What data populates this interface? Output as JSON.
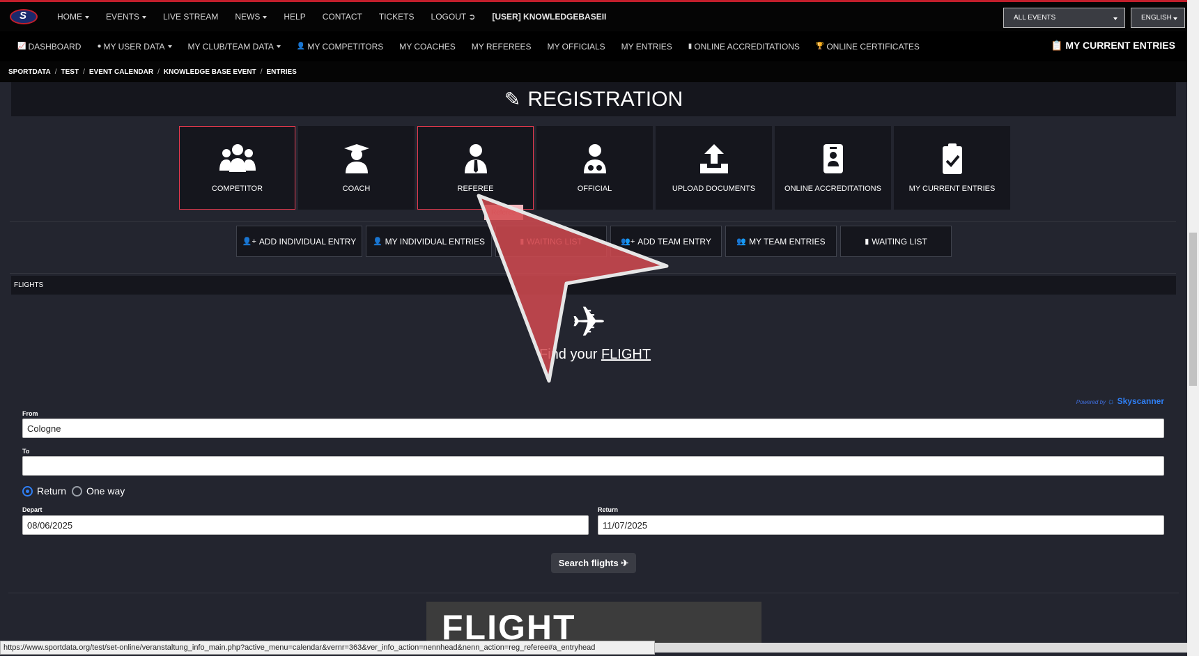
{
  "nav": {
    "home": "HOME",
    "events": "EVENTS",
    "live_stream": "LIVE STREAM",
    "news": "NEWS",
    "help": "HELP",
    "contact": "CONTACT",
    "tickets": "TICKETS",
    "logout": "LOGOUT",
    "user": "[USER] KNOWLEDGEBASEII",
    "events_select": "ALL EVENTS",
    "language_select": "ENGLISH"
  },
  "subnav": {
    "dashboard": "DASHBOARD",
    "my_user_data": "MY USER DATA",
    "my_club_team_data": "MY CLUB/TEAM DATA",
    "my_competitors": "MY COMPETITORS",
    "my_coaches": "MY COACHES",
    "my_referees": "MY REFEREES",
    "my_officials": "MY OFFICIALS",
    "my_entries": "MY ENTRIES",
    "online_accreditations": "ONLINE ACCREDITATIONS",
    "online_certificates": "ONLINE CERTIFICATES",
    "my_current_entries": "MY CURRENT ENTRIES"
  },
  "breadcrumb": [
    "SPORTDATA",
    "TEST",
    "EVENT CALENDAR",
    "KNOWLEDGE BASE EVENT",
    "ENTRIES"
  ],
  "registration": {
    "title": "REGISTRATION",
    "tiles": [
      "COMPETITOR",
      "COACH",
      "REFEREE",
      "OFFICIAL",
      "UPLOAD DOCUMENTS",
      "ONLINE ACCREDITATIONS",
      "MY CURRENT ENTRIES"
    ],
    "tooltip": "Referee"
  },
  "actions": {
    "add_individual_entry": "ADD INDIVIDUAL ENTRY",
    "my_individual_entries": "MY INDIVIDUAL ENTRIES",
    "waiting_list_1": "WAITING LIST",
    "add_team_entry": "ADD TEAM ENTRY",
    "my_team_entries": "MY TEAM ENTRIES",
    "waiting_list_2": "WAITING LIST"
  },
  "flights": {
    "section_title": "FLIGHTS",
    "find_prefix": "Find your",
    "find_link": "FLIGHT",
    "powered_by": "Powered by",
    "provider": "Skyscanner",
    "from_label": "From",
    "from_value": "Cologne",
    "to_label": "To",
    "to_value": "",
    "return_option": "Return",
    "oneway_option": "One way",
    "depart_label": "Depart",
    "depart_value": "08/06/2025",
    "return_label": "Return",
    "return_value": "11/07/2025",
    "search_button": "Search flights",
    "banner_text": "FLIGHT"
  },
  "status_url": "https://www.sportdata.org/test/set-online/veranstaltung_info_main.php?active_menu=calendar&vernr=363&ver_info_action=nennhead&nenn_action=reg_referee#a_entryhead",
  "colors": {
    "accent": "#e83a4e",
    "link_blue": "#2f7ff5",
    "panel": "#15161d",
    "background": "#23252f"
  }
}
